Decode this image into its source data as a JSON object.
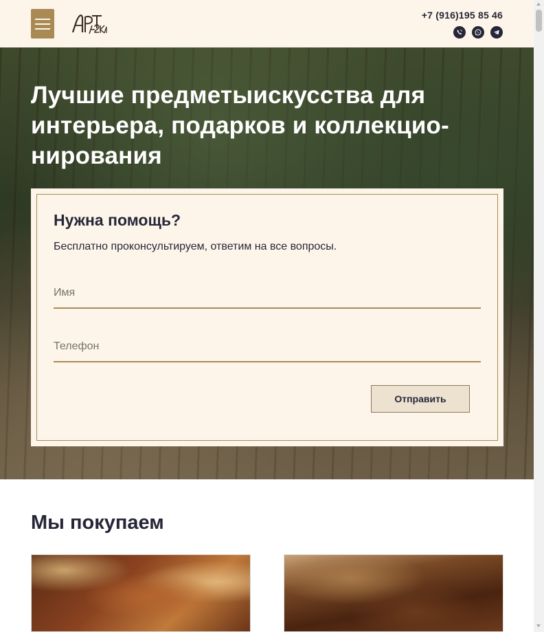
{
  "header": {
    "logo_text": "АРТека",
    "phone": "+7 (916)195 85 46",
    "messengers": [
      "viber-icon",
      "whatsapp-icon",
      "telegram-icon"
    ]
  },
  "hero": {
    "title": "Лучшие предметыискусства для интерьера, подарков и коллекцио­нирования"
  },
  "form": {
    "title": "Нужна помощь?",
    "subtitle": "Бесплатно проконсультируем, ответим на все вопросы.",
    "name_placeholder": "Имя",
    "phone_placeholder": "Телефон",
    "name_value": "",
    "phone_value": "",
    "submit_label": "Отправить"
  },
  "section": {
    "title": "Мы покупаем"
  },
  "colors": {
    "accent": "#a98a55",
    "header_bg": "#fdf5ea",
    "text": "#262638"
  }
}
